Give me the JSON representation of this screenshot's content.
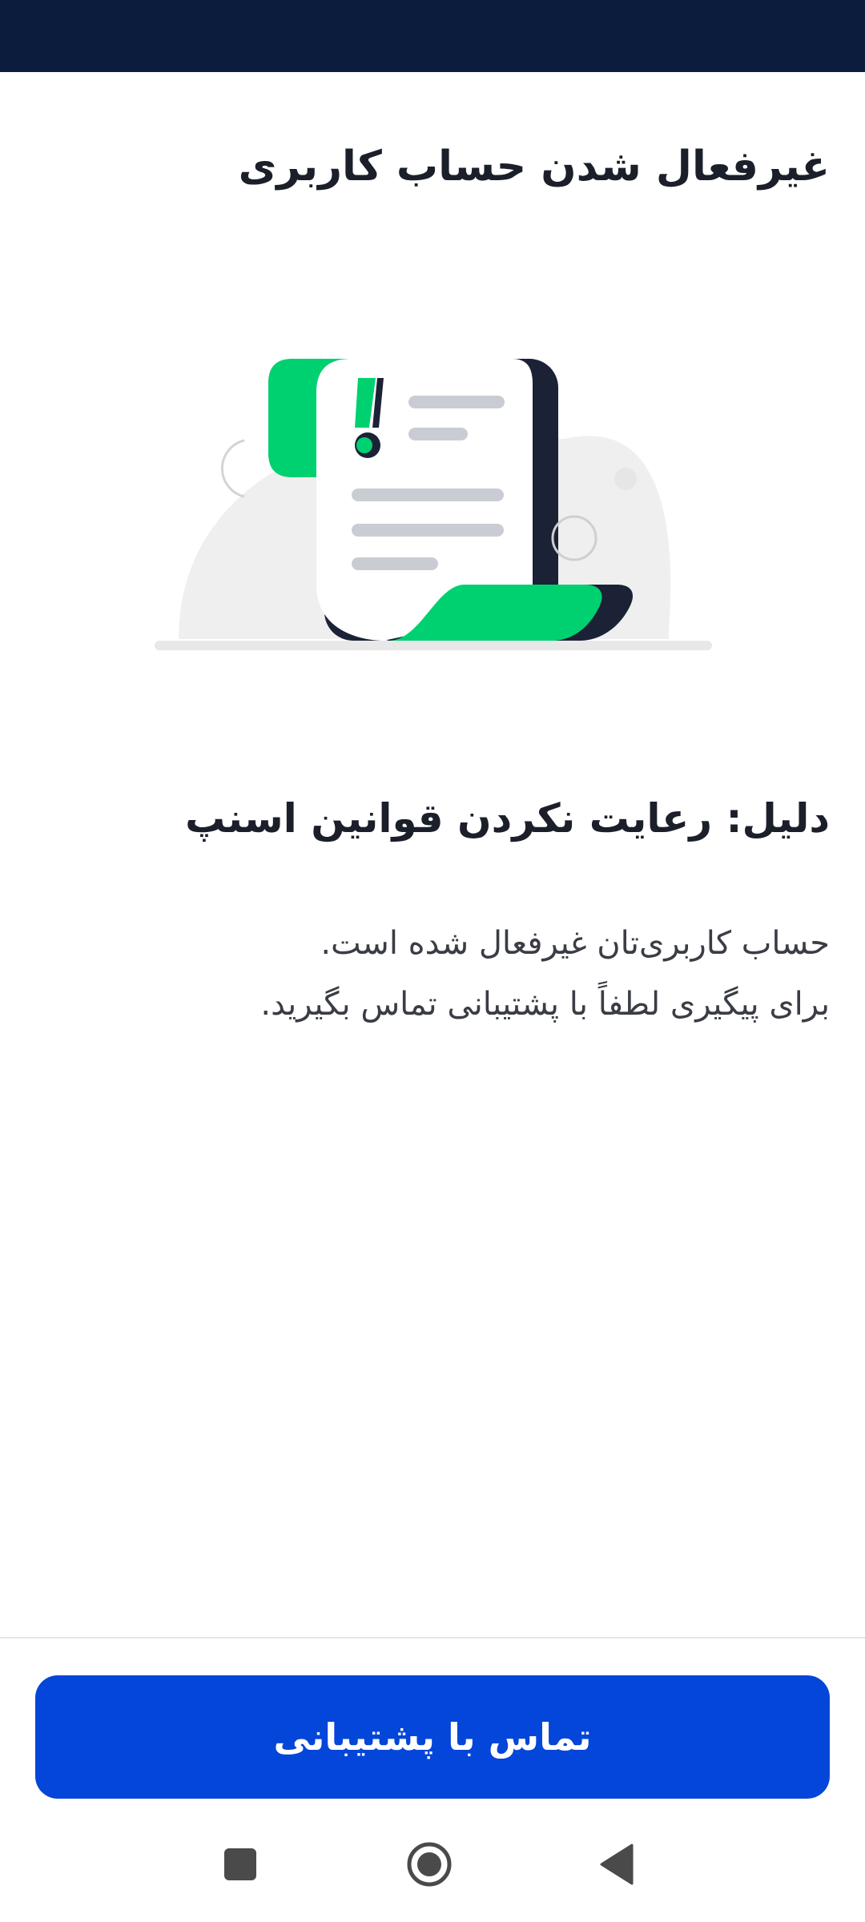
{
  "header": {
    "title": "غیرفعال شدن حساب کاربری"
  },
  "content": {
    "reason": "دلیل: رعایت نکردن قوانین اسنپ",
    "message_line1": "حساب کاربری‌تان غیرفعال شده است.",
    "message_line2": "برای پیگیری لطفاً با پشتیبانی تماس بگیرید."
  },
  "footer": {
    "button_label": "تماس با پشتیبانی"
  },
  "icons": {
    "illustration": "suspended-document-illustration",
    "nav_recent": "square-icon",
    "nav_home": "circle-home-icon",
    "nav_back": "triangle-back-icon"
  },
  "colors": {
    "status_bar": "#0b1c3d",
    "accent_green": "#00d170",
    "primary_blue": "#0446d9",
    "dark": "#1b2236"
  }
}
